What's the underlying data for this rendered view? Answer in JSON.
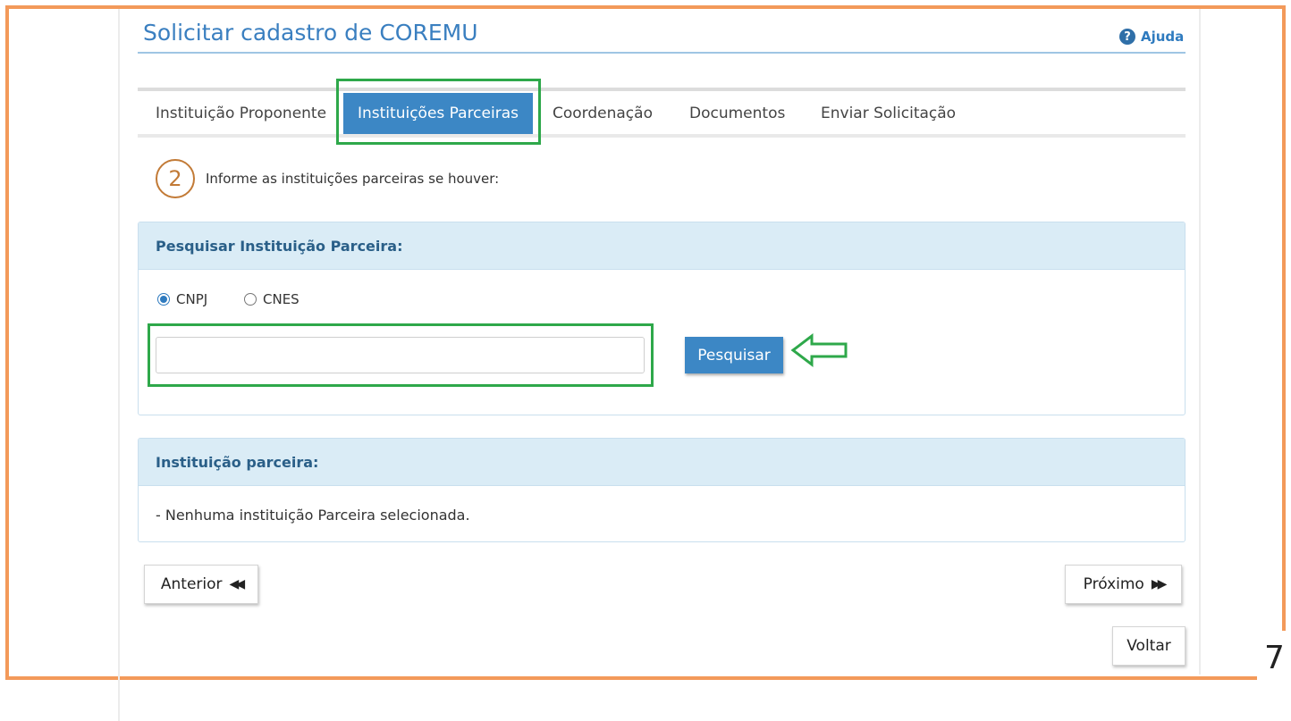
{
  "page": {
    "title": "Solicitar cadastro de COREMU",
    "help_label": "Ajuda",
    "page_number": "7"
  },
  "tabs": [
    {
      "label": "Instituição Proponente",
      "active": false
    },
    {
      "label": "Instituições Parceiras",
      "active": true
    },
    {
      "label": "Coordenação",
      "active": false
    },
    {
      "label": "Documentos",
      "active": false
    },
    {
      "label": "Enviar Solicitação",
      "active": false
    }
  ],
  "step": {
    "number": "2",
    "text": "Informe as instituições parceiras se houver:"
  },
  "search_panel": {
    "title": "Pesquisar Instituição Parceira:",
    "options": [
      {
        "label": "CNPJ",
        "checked": true
      },
      {
        "label": "CNES",
        "checked": false
      }
    ],
    "input_value": "",
    "button_label": "Pesquisar"
  },
  "result_panel": {
    "title": "Instituição parceira:",
    "empty_text": "- Nenhuma instituição Parceira selecionada."
  },
  "nav": {
    "previous_label": "Anterior",
    "next_label": "Próximo",
    "back_label": "Voltar"
  },
  "colors": {
    "accent": "#3c87c5",
    "frame": "#f39a5a",
    "highlight": "#2ea84a"
  }
}
